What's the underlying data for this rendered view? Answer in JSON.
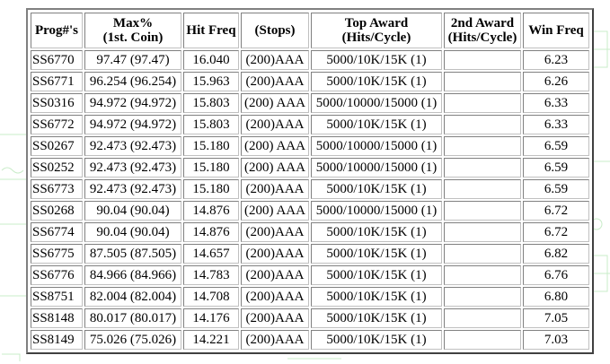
{
  "headers": [
    {
      "line1": "Prog#'s",
      "line2": ""
    },
    {
      "line1": "Max%",
      "line2": "(1st. Coin)"
    },
    {
      "line1": "Hit Freq",
      "line2": ""
    },
    {
      "line1": "(Stops)",
      "line2": ""
    },
    {
      "line1": "Top Award",
      "line2": "(Hits/Cycle)"
    },
    {
      "line1": "2nd Award",
      "line2": "(Hits/Cycle)"
    },
    {
      "line1": "Win Freq",
      "line2": ""
    }
  ],
  "rows": [
    {
      "prog": "SS6770",
      "max": "97.47 (97.47)",
      "hit": "16.040",
      "stops": "(200)AAA",
      "top": "5000/10K/15K (1)",
      "second": "",
      "win": "6.23"
    },
    {
      "prog": "SS6771",
      "max": "96.254 (96.254)",
      "hit": "15.963",
      "stops": "(200)AAA",
      "top": "5000/10K/15K (1)",
      "second": "",
      "win": "6.26"
    },
    {
      "prog": "SS0316",
      "max": "94.972 (94.972)",
      "hit": "15.803",
      "stops": "(200) AAA",
      "top": "5000/10000/15000 (1)",
      "second": "",
      "win": "6.33"
    },
    {
      "prog": "SS6772",
      "max": "94.972 (94.972)",
      "hit": "15.803",
      "stops": "(200)AAA",
      "top": "5000/10K/15K (1)",
      "second": "",
      "win": "6.33"
    },
    {
      "prog": "SS0267",
      "max": "92.473 (92.473)",
      "hit": "15.180",
      "stops": "(200) AAA",
      "top": "5000/10000/15000 (1)",
      "second": "",
      "win": "6.59"
    },
    {
      "prog": "SS0252",
      "max": "92.473 (92.473)",
      "hit": "15.180",
      "stops": "(200) AAA",
      "top": "5000/10000/15000 (1)",
      "second": "",
      "win": "6.59"
    },
    {
      "prog": "SS6773",
      "max": "92.473 (92.473)",
      "hit": "15.180",
      "stops": "(200)AAA",
      "top": "5000/10K/15K (1)",
      "second": "",
      "win": "6.59"
    },
    {
      "prog": "SS0268",
      "max": "90.04 (90.04)",
      "hit": "14.876",
      "stops": "(200) AAA",
      "top": "5000/10000/15000 (1)",
      "second": "",
      "win": "6.72"
    },
    {
      "prog": "SS6774",
      "max": "90.04 (90.04)",
      "hit": "14.876",
      "stops": "(200)AAA",
      "top": "5000/10K/15K (1)",
      "second": "",
      "win": "6.72"
    },
    {
      "prog": "SS6775",
      "max": "87.505 (87.505)",
      "hit": "14.657",
      "stops": "(200)AAA",
      "top": "5000/10K/15K (1)",
      "second": "",
      "win": "6.82"
    },
    {
      "prog": "SS6776",
      "max": "84.966 (84.966)",
      "hit": "14.783",
      "stops": "(200)AAA",
      "top": "5000/10K/15K (1)",
      "second": "",
      "win": "6.76"
    },
    {
      "prog": "SS8751",
      "max": "82.004 (82.004)",
      "hit": "14.708",
      "stops": "(200)AAA",
      "top": "5000/10K/15K (1)",
      "second": "",
      "win": "6.80"
    },
    {
      "prog": "SS8148",
      "max": "80.017 (80.017)",
      "hit": "14.176",
      "stops": "(200)AAA",
      "top": "5000/10K/15K (1)",
      "second": "",
      "win": "7.05"
    },
    {
      "prog": "SS8149",
      "max": "75.026 (75.026)",
      "hit": "14.221",
      "stops": "(200)AAA",
      "top": "5000/10K/15K (1)",
      "second": "",
      "win": "7.03"
    }
  ],
  "colors": {
    "background": "#ffffff",
    "watermark": "#c8ecc8",
    "border_dark": "#808080",
    "border_light": "#c0c0c0"
  }
}
